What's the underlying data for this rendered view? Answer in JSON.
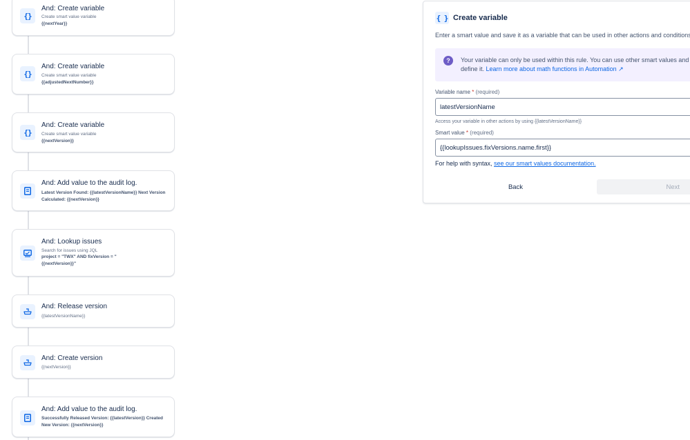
{
  "flow": {
    "cards": [
      {
        "title": "And: Create variable",
        "subtitle": "Create smart value variable",
        "value": "{{nextYear}}",
        "icon": "braces-icon"
      },
      {
        "title": "And: Create variable",
        "subtitle": "Create smart value variable",
        "value": "{{adjustedNextNumber}}",
        "icon": "braces-icon"
      },
      {
        "title": "And: Create variable",
        "subtitle": "Create smart value variable",
        "value": "{{nextVersion}}",
        "icon": "braces-icon"
      },
      {
        "title": "And: Add value to the audit log.",
        "value": "Latest Version Found: {{latestVersionName}} Next Version Calculated: {{nextVersion}}",
        "icon": "document-icon"
      },
      {
        "title": "And: Lookup issues",
        "subtitle": "Search for issues using JQL",
        "value": "project = \"TWX\" AND fixVersion = \"{{nextVersion}}\"",
        "icon": "search-issues-icon"
      },
      {
        "title": "And: Release version",
        "subtitle": "{{latestVersionName}}",
        "icon": "ship-icon"
      },
      {
        "title": "And: Create version",
        "subtitle": "{{nextVersion}}",
        "icon": "ship-icon"
      },
      {
        "title": "And: Add value to the audit log.",
        "value": "Successfully Released Version: {{latestVersion}} Created New Version: {{nextVersion}}",
        "icon": "document-icon"
      }
    ]
  },
  "panel": {
    "icon": "braces-icon",
    "icon_glyph": "{ }",
    "title": "Create variable",
    "description": "Enter a smart value and save it as a variable that can be used in other actions and conditions",
    "info": {
      "icon_glyph": "?",
      "line1": "Your variable can only be used within this rule. You can use other smart values and",
      "line2_prefix": "define it. ",
      "link": "Learn more about math functions in Automation ↗"
    },
    "variable_name": {
      "label": "Variable name",
      "required_mark": "*",
      "required_text": "(required)",
      "value": "latestVersionName",
      "help": "Access your variable in other actions by using {{latestVersionName}}"
    },
    "smart_value": {
      "label": "Smart value",
      "required_mark": "*",
      "required_text": "(required)",
      "value": "{{lookupIssues.fixVersions.name.first}}",
      "help_prefix": "For help with syntax, ",
      "help_link": "see our smart values documentation."
    },
    "back_label": "Back",
    "next_label": "Next"
  },
  "colors": {
    "accent": "#0c66e4",
    "info_bg": "#f3f0ff",
    "info_icon": "#6e5dc6",
    "required": "#c9372c"
  }
}
